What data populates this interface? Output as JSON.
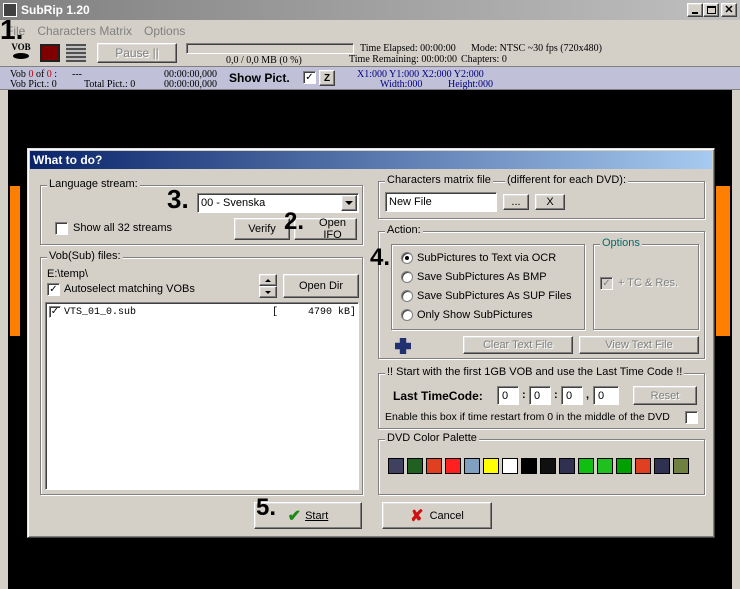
{
  "app": {
    "title": "SubRip 1.20"
  },
  "menu": [
    "File",
    "Characters Matrix",
    "Options"
  ],
  "toolbar": {
    "pause_label": "Pause ||",
    "progress": "0,0 / 0,0 MB (0 %)",
    "progress_fraction": 0,
    "time_elapsed": "Time Elapsed: 00:00:00",
    "time_remaining": "Time Remaining: 00:00:00",
    "mode": "Mode: NTSC ~30 fps (720x480)",
    "chapters": "Chapters: 0"
  },
  "status": {
    "vob": "Vob",
    "vob_num": "0",
    "of": "of",
    "of_num": "0",
    "colon": ":",
    "dash": "---",
    "vob_pict": "Vob Pict.: 0",
    "total_pict": "Total Pict.: 0",
    "time1": "00:00:00,000",
    "time2": "00:00:00,000",
    "show_pict": "Show Pict.",
    "show_pict_checked": "✓",
    "z_label": "Z",
    "coords": "X1:000  Y1:000  X2:000  Y2:000",
    "width": "Width:000",
    "height": "Height:000"
  },
  "dialog": {
    "title": "What to do?",
    "language": {
      "legend": "Language stream:",
      "selected": "00 - Svenska",
      "show_all": "Show all 32 streams",
      "verify": "Verify",
      "open_ifo": "Open IFO"
    },
    "vob": {
      "legend": "Vob(Sub) files:",
      "path": "E:\\temp\\",
      "autoselect": "Autoselect matching VOBs",
      "autoselect_checked": "✓",
      "open_dir": "Open Dir",
      "files": [
        {
          "checked": "✓",
          "name": "VTS_01_0.sub",
          "bracket": "[",
          "size": "4790 kB]"
        }
      ]
    },
    "matrix": {
      "legend": "Characters matrix file",
      "note": "(different for each DVD):",
      "value": "New File",
      "browse": "...",
      "clear": "X"
    },
    "action": {
      "legend": "Action:",
      "options": [
        "SubPictures to Text via OCR",
        "Save SubPictures As BMP",
        "Save SubPictures As SUP Files",
        "Only Show SubPictures"
      ],
      "selected": 0,
      "options_legend": "Options",
      "tc_res": "+ TC & Res.",
      "tc_checked": "✓",
      "clear_text": "Clear Text File",
      "view_text": "View Text File"
    },
    "timecode": {
      "legend": "!! Start with the first 1GB VOB and use the Last Time Code !!",
      "label": "Last TimeCode:",
      "fields": [
        "0",
        "0",
        "0",
        "0"
      ],
      "sep_colon": ":",
      "sep_comma": ",",
      "reset": "Reset",
      "enable_text": "Enable this box if time restart from 0 in the middle of the DVD"
    },
    "palette": {
      "legend": "DVD Color Palette",
      "colors": [
        "#404060",
        "#206020",
        "#e04020",
        "#ff2020",
        "#80a0c0",
        "#ffff00",
        "#ffffff",
        "#000000",
        "#101010",
        "#303050",
        "#10c010",
        "#20c020",
        "#00a000",
        "#e04020",
        "#303050",
        "#708040"
      ]
    },
    "start": "Start",
    "cancel": "Cancel"
  },
  "annotations": {
    "n1": "1.",
    "n2": "2.",
    "n3": "3.",
    "n4": "4.",
    "n5": "5."
  },
  "colors": {
    "accent_orange": "#ff8000",
    "title_blue": "#0a246a",
    "title_blue2": "#a6caf0"
  }
}
